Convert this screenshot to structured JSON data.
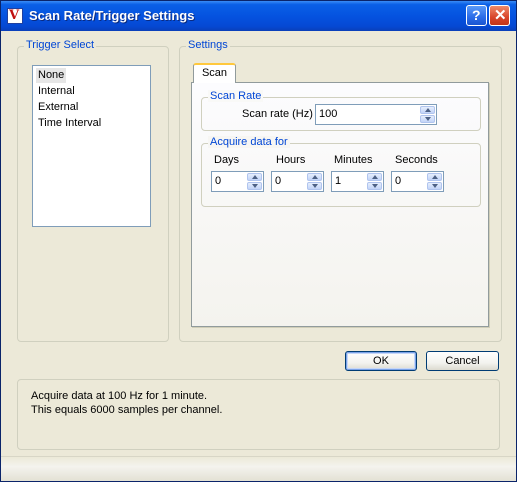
{
  "window": {
    "title": "Scan Rate/Trigger Settings",
    "app_icon_glyph": "V",
    "help_glyph": "?",
    "close_glyph": "✕"
  },
  "trigger_select": {
    "title": "Trigger Select",
    "items": [
      {
        "label": "None",
        "selected": true
      },
      {
        "label": "Internal",
        "selected": false
      },
      {
        "label": "External",
        "selected": false
      },
      {
        "label": "Time Interval",
        "selected": false
      }
    ]
  },
  "settings": {
    "title": "Settings",
    "tabs": [
      {
        "label": "Scan",
        "active": true
      }
    ],
    "scan_rate": {
      "title": "Scan Rate",
      "label": "Scan rate (Hz)",
      "value": "100"
    },
    "acquire": {
      "title": "Acquire data for",
      "fields": [
        {
          "label": "Days",
          "value": "0"
        },
        {
          "label": "Hours",
          "value": "0"
        },
        {
          "label": "Minutes",
          "value": "1"
        },
        {
          "label": "Seconds",
          "value": "0"
        }
      ]
    }
  },
  "buttons": {
    "ok": "OK",
    "cancel": "Cancel"
  },
  "info": {
    "line1": "Acquire data at 100 Hz for 1 minute.",
    "line2": "This equals 6000 samples per channel."
  },
  "colors": {
    "title_bar": "#0553e0",
    "group_title": "#0046d5",
    "face": "#ece9d8",
    "tab_highlight": "#ffc83c"
  },
  "icons": [
    "app-logo-icon",
    "help-icon",
    "close-icon",
    "spin-up-arrow-icon",
    "spin-down-arrow-icon"
  ]
}
